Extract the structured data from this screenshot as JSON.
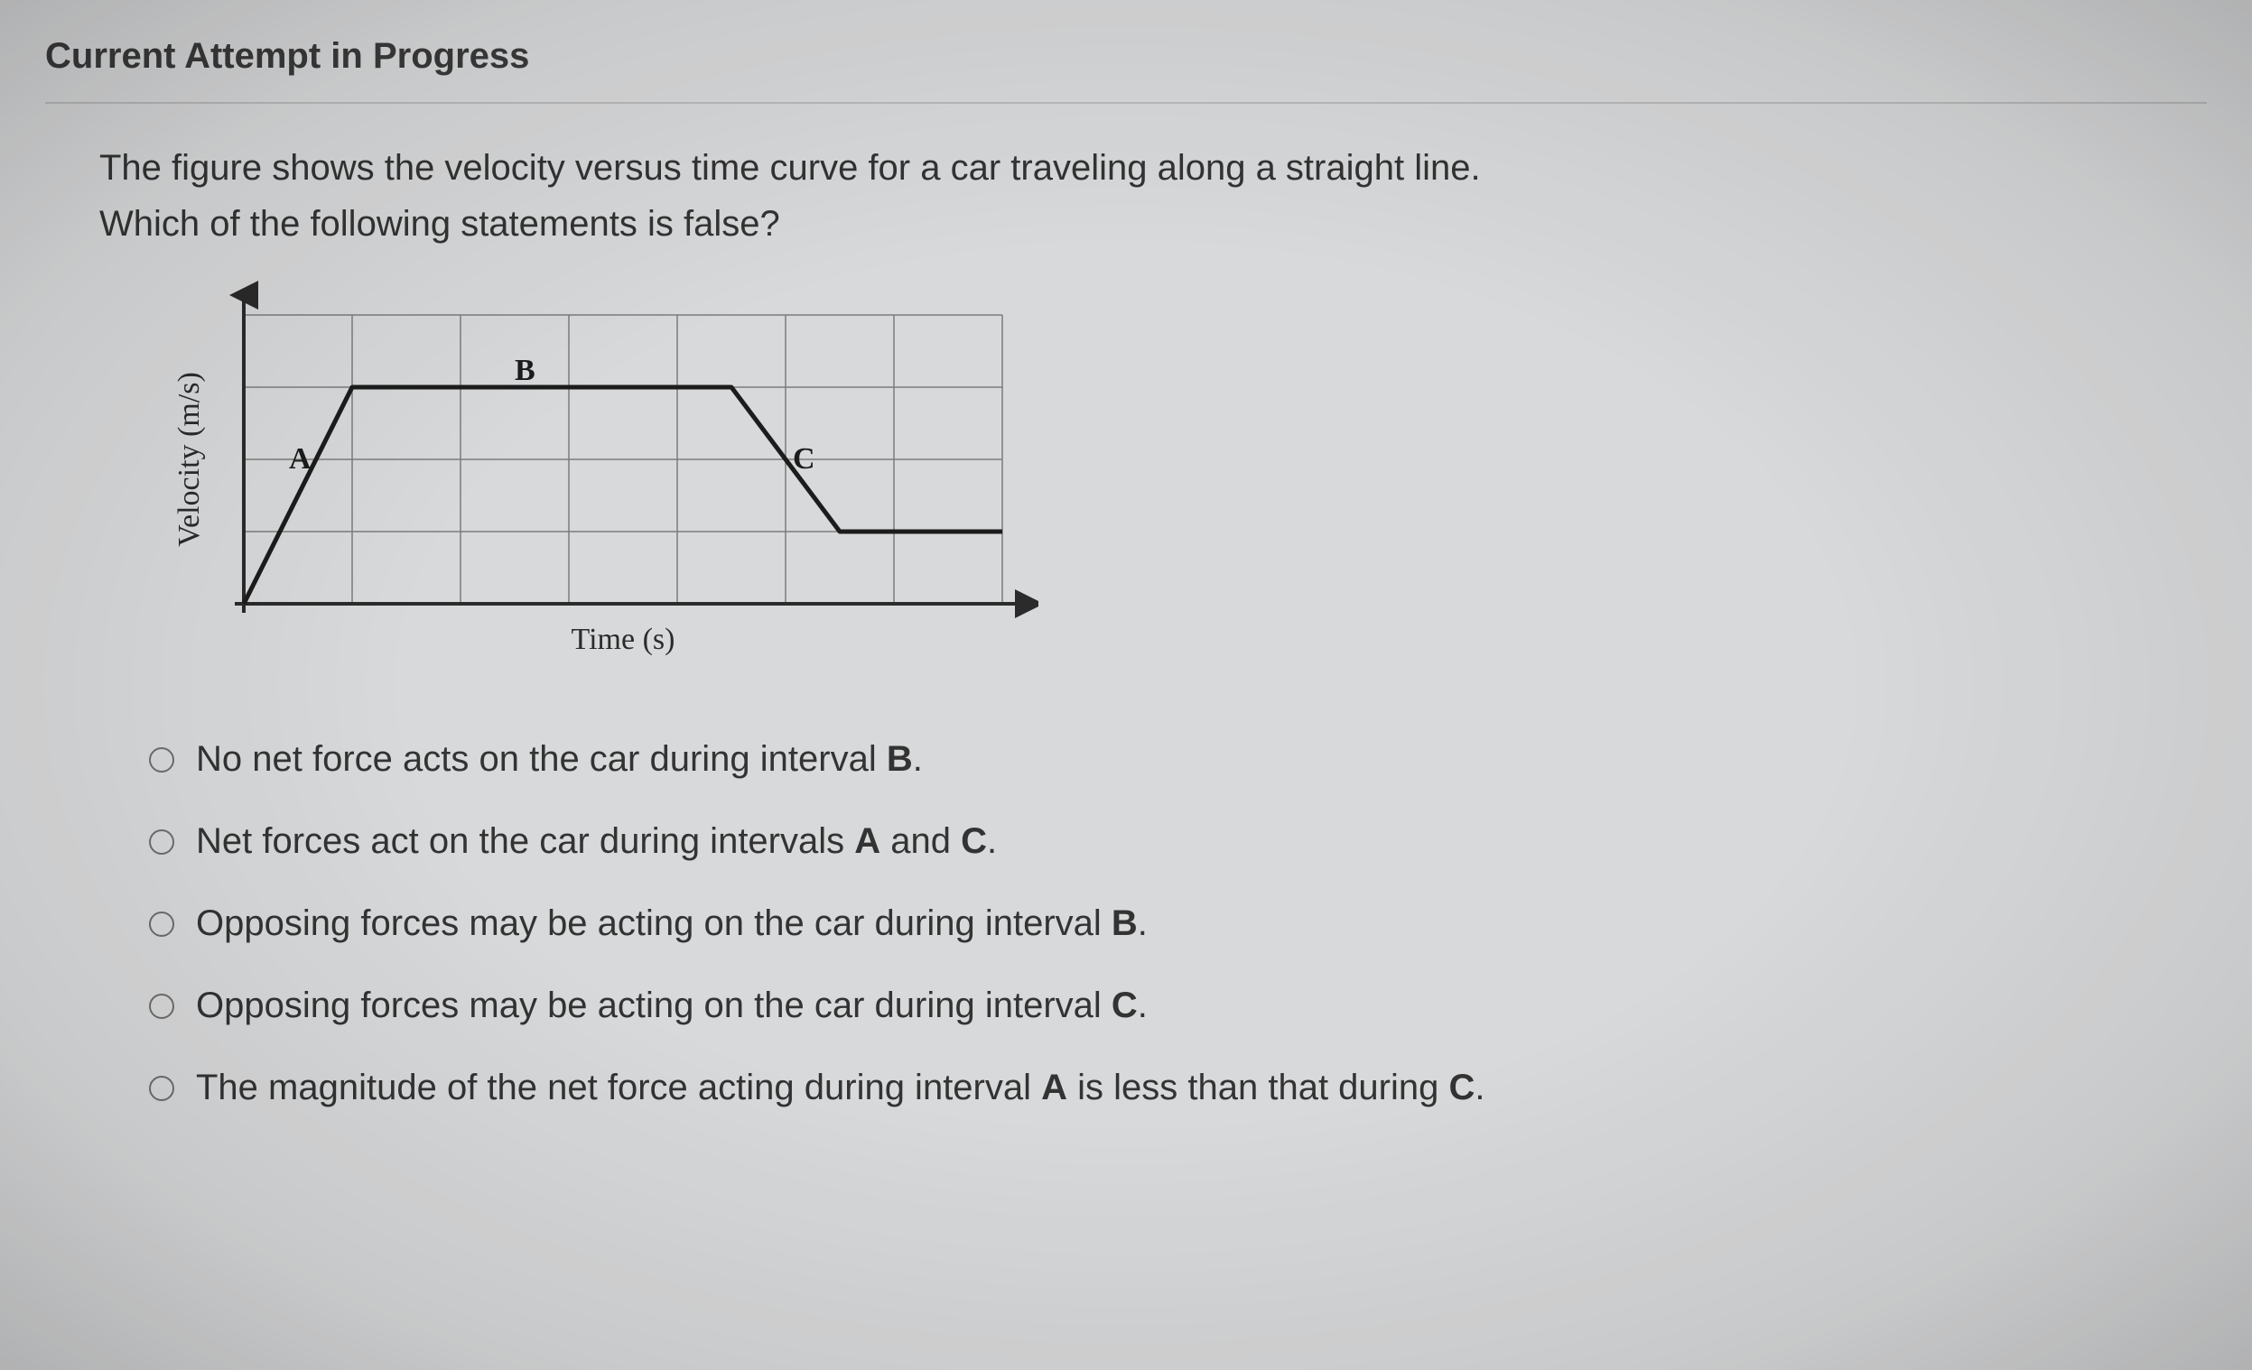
{
  "header": "Current Attempt in Progress",
  "question": {
    "line1": "The figure shows the velocity versus time curve for a car traveling along a straight line.",
    "line2": "Which of the following statements is false?"
  },
  "chart_data": {
    "type": "line",
    "title": "",
    "xlabel": "Time (s)",
    "ylabel": "Velocity (m/s)",
    "xlim": [
      0,
      7
    ],
    "ylim": [
      0,
      4
    ],
    "grid": true,
    "series": [
      {
        "name": "velocity-curve",
        "x": [
          0,
          1,
          4.5,
          5.5,
          7
        ],
        "y": [
          0,
          3,
          3,
          1,
          1
        ]
      }
    ],
    "annotations": [
      {
        "label": "A",
        "x": 0.55,
        "y": 2.0
      },
      {
        "label": "B",
        "x": 2.55,
        "y": 3.15
      },
      {
        "label": "C",
        "x": 5.15,
        "y": 2.05
      }
    ]
  },
  "options": [
    {
      "id": "opt1",
      "prefix": "No net force acts on the car during interval ",
      "bold": "B",
      "suffix": "."
    },
    {
      "id": "opt2",
      "prefix": "Net forces act on the car during intervals ",
      "bold": "A",
      "mid": " and ",
      "bold2": "C",
      "suffix": "."
    },
    {
      "id": "opt3",
      "prefix": "Opposing forces may be acting on the car during interval ",
      "bold": "B",
      "suffix": "."
    },
    {
      "id": "opt4",
      "prefix": "Opposing forces may be acting on the car during interval ",
      "bold": "C",
      "suffix": "."
    },
    {
      "id": "opt5",
      "prefix": "The magnitude of the net force acting during interval ",
      "bold": "A",
      "mid": " is less than that during ",
      "bold2": "C",
      "suffix": "."
    }
  ]
}
